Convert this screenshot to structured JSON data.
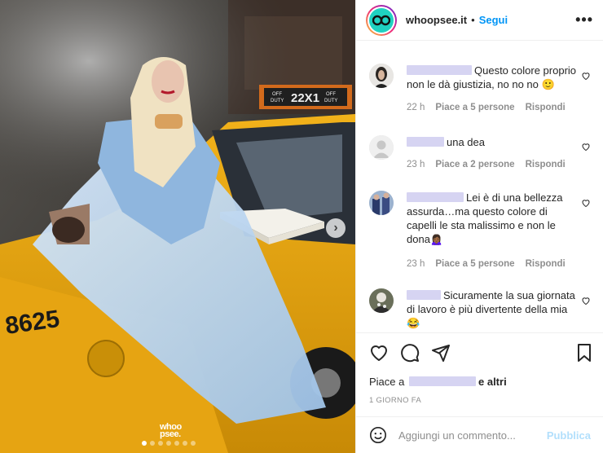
{
  "header": {
    "username": "whoopsee.it",
    "separator": "•",
    "follow_label": "Segui",
    "more_icon": "more-horizontal-icon",
    "more_label": "•••"
  },
  "photo": {
    "watermark_line1": "whoo",
    "watermark_line2": "psee.",
    "taxi_sign_left": "OFF DUTY",
    "taxi_sign_number": "22X1",
    "taxi_sign_right": "OFF DUTY",
    "taxi_number": "8625",
    "carousel_count": 7,
    "carousel_active": 0,
    "next_icon": "chevron-right-icon"
  },
  "comments": [
    {
      "text": "Questo colore proprio non le dà giustizia, no no no 🙂",
      "time": "22 h",
      "likes": "Piace a 5 persone",
      "reply": "Rispondi"
    },
    {
      "text": "una dea",
      "time": "23 h",
      "likes": "Piace a 2 persone",
      "reply": "Rispondi"
    },
    {
      "text": "Lei è di una bellezza assurda…ma questo colore di capelli le sta malissimo e non le dona🙍🏾‍♀️",
      "time": "23 h",
      "likes": "Piace a 5 persone",
      "reply": "Rispondi"
    },
    {
      "text": "Sicuramente la sua giornata di lavoro è più divertente della mia 😂",
      "time": "",
      "likes": "",
      "reply": ""
    }
  ],
  "actions": {
    "likes_prefix": "Piace a",
    "likes_suffix": "e altri",
    "date": "1 GIORNO FA"
  },
  "add_comment": {
    "placeholder": "Aggiungi un commento...",
    "publish_label": "Pubblica"
  },
  "colors": {
    "link_blue": "#0095f6",
    "publish_disabled": "#b2dffc",
    "muted_text": "#8e8e8e"
  }
}
